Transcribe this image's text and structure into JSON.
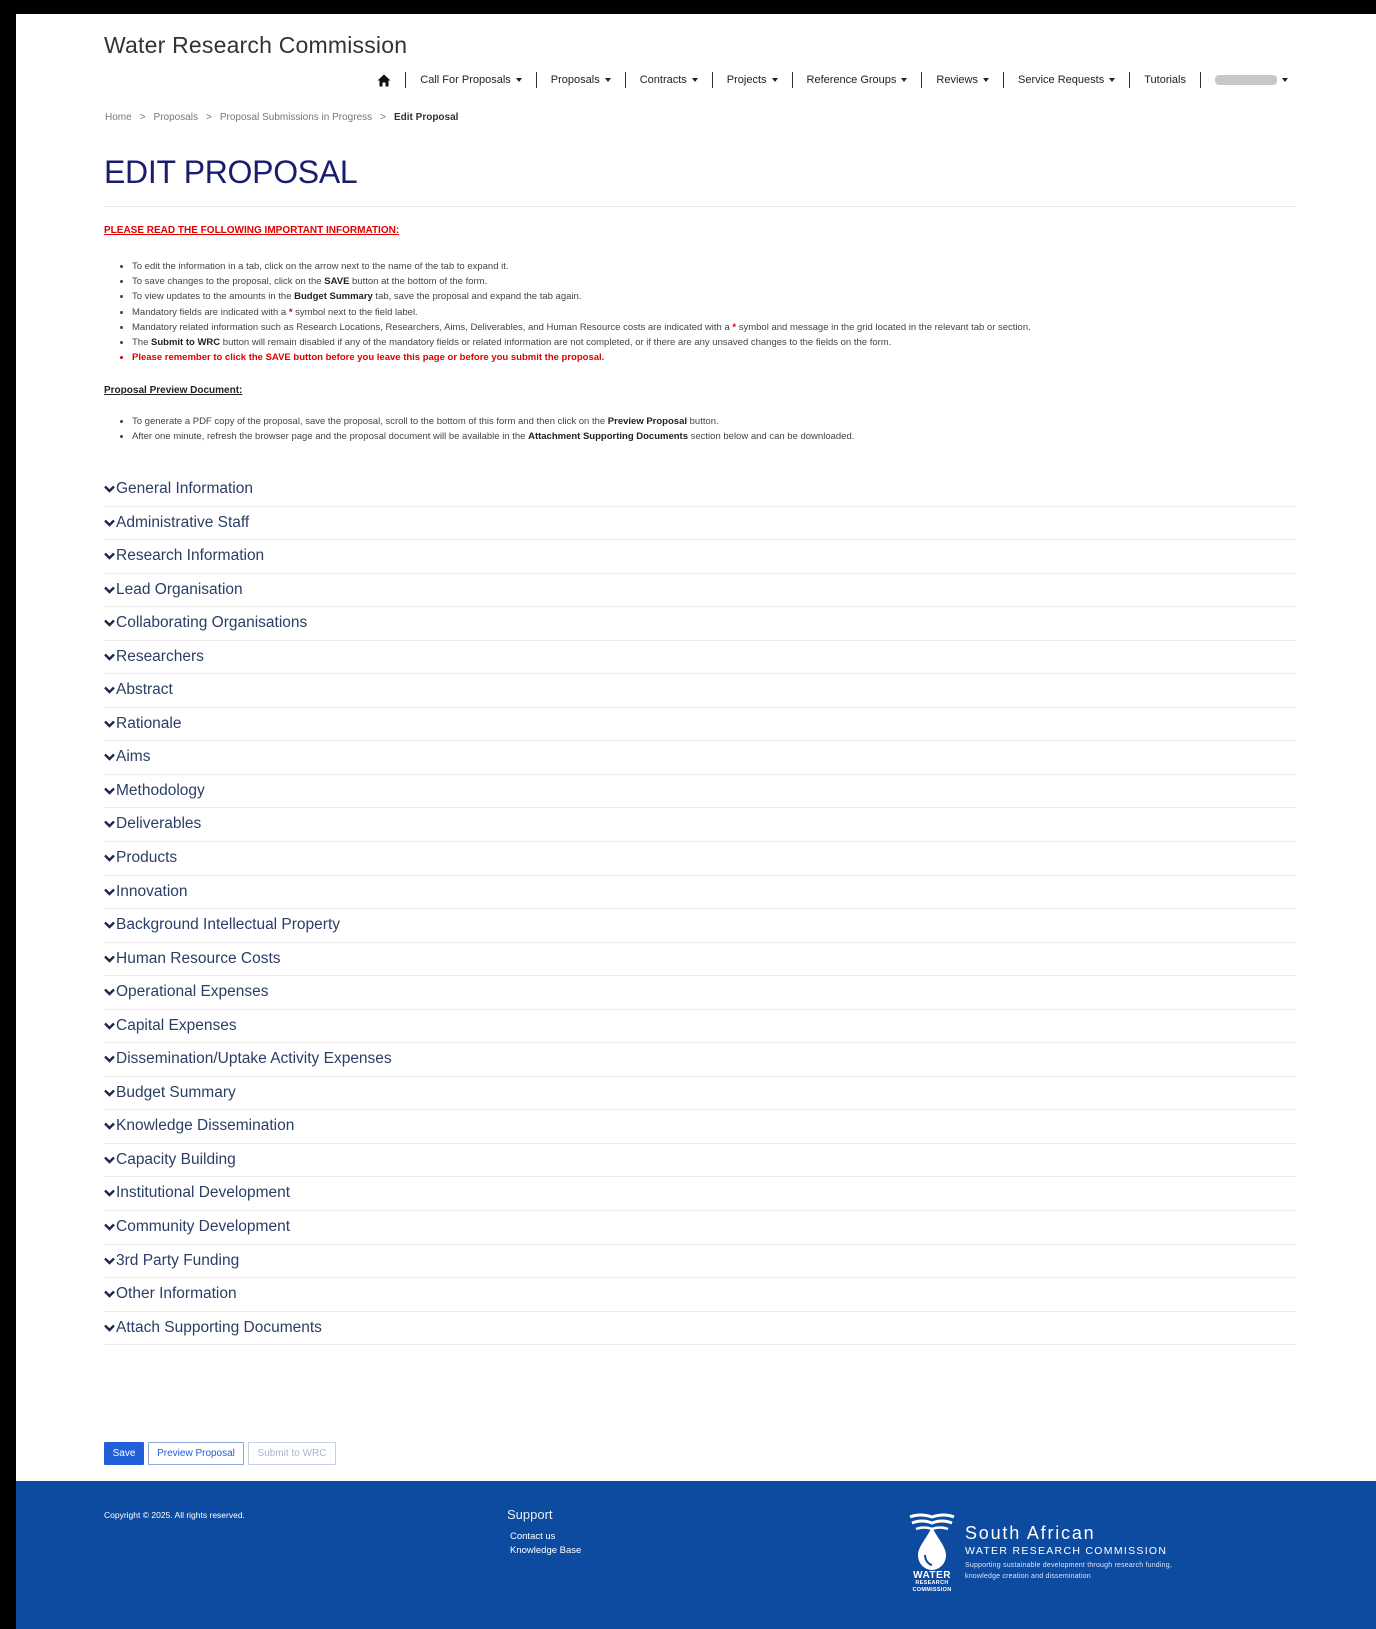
{
  "header": {
    "brand": "Water Research Commission",
    "nav": [
      {
        "label": "Call For Proposals",
        "dropdown": true
      },
      {
        "label": "Proposals",
        "dropdown": true
      },
      {
        "label": "Contracts",
        "dropdown": true
      },
      {
        "label": "Projects",
        "dropdown": true
      },
      {
        "label": "Reference Groups",
        "dropdown": true
      },
      {
        "label": "Reviews",
        "dropdown": true
      },
      {
        "label": "Service Requests",
        "dropdown": true
      },
      {
        "label": "Tutorials",
        "dropdown": false
      }
    ],
    "icons": {
      "home": "home-icon",
      "user": "user-menu (name blurred)"
    }
  },
  "breadcrumb": [
    "Home",
    "Proposals",
    "Proposal Submissions in Progress",
    "Edit Proposal"
  ],
  "page_title": "EDIT PROPOSAL",
  "important": {
    "heading": "PLEASE READ THE FOLLOWING IMPORTANT INFORMATION:",
    "items": [
      {
        "parts": [
          {
            "t": "To edit the information in a tab, click on the arrow next to the name of the tab to expand it."
          }
        ]
      },
      {
        "parts": [
          {
            "t": "To save changes to the proposal, click on the "
          },
          {
            "t": "SAVE",
            "b": true
          },
          {
            "t": " button at the bottom of the form."
          }
        ]
      },
      {
        "parts": [
          {
            "t": "To view updates to the amounts in the "
          },
          {
            "t": "Budget Summary",
            "b": true
          },
          {
            "t": " tab, save the proposal and expand the tab again."
          }
        ]
      },
      {
        "parts": [
          {
            "t": "Mandatory fields are indicated with a "
          },
          {
            "t": "*",
            "s": true
          },
          {
            "t": " symbol next to the field label."
          }
        ]
      },
      {
        "parts": [
          {
            "t": "Mandatory related information such as Research Locations, Researchers, Aims, Deliverables, and Human Resource costs are indicated with a "
          },
          {
            "t": "*",
            "s": true
          },
          {
            "t": " symbol and message in the grid located in the relevant tab or section."
          }
        ]
      },
      {
        "parts": [
          {
            "t": "The "
          },
          {
            "t": "Submit to WRC",
            "b": true
          },
          {
            "t": " button will remain disabled if any of the mandatory fields or related information are not completed, or if there are any unsaved changes to the fields on the form."
          }
        ]
      },
      {
        "alert": true,
        "parts": [
          {
            "t": "Please remember to click the SAVE button before you leave this page or before you submit the proposal."
          }
        ]
      }
    ]
  },
  "preview": {
    "heading": "Proposal Preview Document:",
    "items": [
      {
        "parts": [
          {
            "t": "To generate a PDF copy of the proposal, save the proposal, scroll to the bottom of this form and then click on the "
          },
          {
            "t": "Preview Proposal",
            "b": true
          },
          {
            "t": " button."
          }
        ]
      },
      {
        "parts": [
          {
            "t": "After one minute, refresh the browser page and the proposal document will be available in the "
          },
          {
            "t": "Attachment Supporting Documents",
            "b": true
          },
          {
            "t": " section below and can be downloaded."
          }
        ]
      }
    ]
  },
  "sections": [
    "General Information",
    "Administrative Staff",
    "Research Information",
    "Lead Organisation",
    "Collaborating Organisations",
    "Researchers",
    "Abstract",
    "Rationale",
    "Aims",
    "Methodology",
    "Deliverables",
    "Products",
    "Innovation",
    "Background Intellectual Property",
    "Human Resource Costs",
    "Operational Expenses",
    "Capital Expenses",
    "Dissemination/Uptake Activity Expenses",
    "Budget Summary",
    "Knowledge Dissemination",
    "Capacity Building",
    "Institutional Development",
    "Community Development",
    "3rd Party Funding",
    "Other Information",
    "Attach Supporting Documents"
  ],
  "buttons": {
    "save": "Save",
    "preview": "Preview Proposal",
    "submit": "Submit to WRC"
  },
  "footer": {
    "copyright": "Copyright © 2025. All rights reserved.",
    "support_title": "Support",
    "support_links": [
      "Contact us",
      "Knowledge Base"
    ],
    "logo": {
      "line1": "South African",
      "line2": "WATER RESEARCH COMMISSION",
      "tagline": "Supporting sustainable development through research funding, knowledge creation and dissemination",
      "mark_word": "WATER",
      "mark_sub1": "RESEARCH",
      "mark_sub2": "COMMISSION"
    }
  },
  "colors": {
    "title": "#1a1d6e",
    "section_label": "#2b3e66",
    "alert": "#e00000",
    "primary": "#2160d8",
    "footer_bg": "#0d4ba0"
  }
}
